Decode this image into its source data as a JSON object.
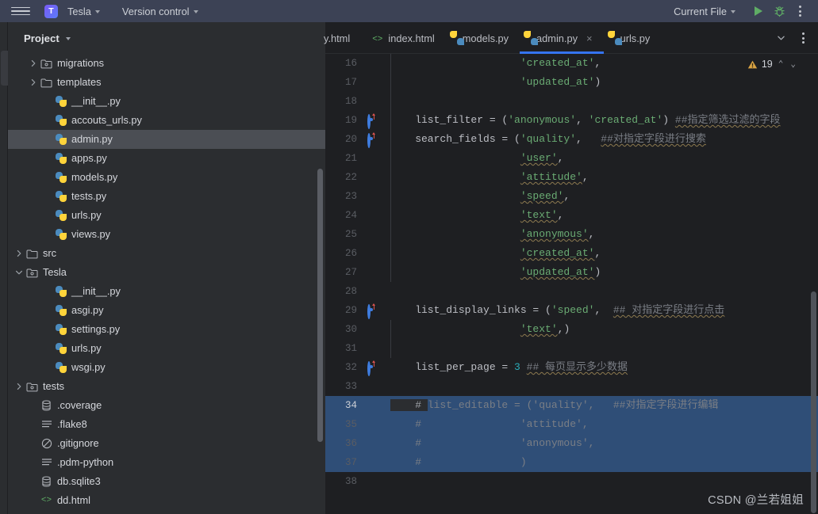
{
  "titlebar": {
    "menu_icon": "hamburger-icon",
    "project_badge": "T",
    "project_name": "Tesla",
    "version_control": "Version control",
    "run_config": "Current File",
    "run_icon": "run-play-icon",
    "debug_icon": "debug-bug-icon",
    "more_icon": "more-vertical-icon"
  },
  "project_panel": {
    "title": "Project",
    "tree": [
      {
        "label": "migrations",
        "icon": "folder-module-icon",
        "indent": 3,
        "arrow": "right",
        "selected": false
      },
      {
        "label": "templates",
        "icon": "folder-icon",
        "indent": 3,
        "arrow": "right",
        "selected": false
      },
      {
        "label": "__init__.py",
        "icon": "python-icon",
        "indent": 4,
        "arrow": "none",
        "selected": false
      },
      {
        "label": "accouts_urls.py",
        "icon": "python-icon",
        "indent": 4,
        "arrow": "none",
        "selected": false
      },
      {
        "label": "admin.py",
        "icon": "python-icon",
        "indent": 4,
        "arrow": "none",
        "selected": true
      },
      {
        "label": "apps.py",
        "icon": "python-icon",
        "indent": 4,
        "arrow": "none",
        "selected": false
      },
      {
        "label": "models.py",
        "icon": "python-icon",
        "indent": 4,
        "arrow": "none",
        "selected": false
      },
      {
        "label": "tests.py",
        "icon": "python-icon",
        "indent": 4,
        "arrow": "none",
        "selected": false
      },
      {
        "label": "urls.py",
        "icon": "python-icon",
        "indent": 4,
        "arrow": "none",
        "selected": false
      },
      {
        "label": "views.py",
        "icon": "python-icon",
        "indent": 4,
        "arrow": "none",
        "selected": false
      },
      {
        "label": "src",
        "icon": "folder-icon",
        "indent": 2,
        "arrow": "right",
        "selected": false
      },
      {
        "label": "Tesla",
        "icon": "folder-module-icon",
        "indent": 2,
        "arrow": "down",
        "selected": false
      },
      {
        "label": "__init__.py",
        "icon": "python-icon",
        "indent": 4,
        "arrow": "none",
        "selected": false
      },
      {
        "label": "asgi.py",
        "icon": "python-icon",
        "indent": 4,
        "arrow": "none",
        "selected": false
      },
      {
        "label": "settings.py",
        "icon": "python-icon",
        "indent": 4,
        "arrow": "none",
        "selected": false
      },
      {
        "label": "urls.py",
        "icon": "python-icon",
        "indent": 4,
        "arrow": "none",
        "selected": false
      },
      {
        "label": "wsgi.py",
        "icon": "python-icon",
        "indent": 4,
        "arrow": "none",
        "selected": false
      },
      {
        "label": "tests",
        "icon": "folder-module-icon",
        "indent": 2,
        "arrow": "right",
        "selected": false
      },
      {
        "label": ".coverage",
        "icon": "database-icon",
        "indent": 3,
        "arrow": "none",
        "selected": false
      },
      {
        "label": ".flake8",
        "icon": "text-file-icon",
        "indent": 3,
        "arrow": "none",
        "selected": false
      },
      {
        "label": ".gitignore",
        "icon": "ignore-file-icon",
        "indent": 3,
        "arrow": "none",
        "selected": false
      },
      {
        "label": ".pdm-python",
        "icon": "text-file-icon",
        "indent": 3,
        "arrow": "none",
        "selected": false
      },
      {
        "label": "db.sqlite3",
        "icon": "database-icon",
        "indent": 3,
        "arrow": "none",
        "selected": false
      },
      {
        "label": "dd.html",
        "icon": "html-icon",
        "indent": 3,
        "arrow": "none",
        "selected": false
      }
    ]
  },
  "editor_tabs": {
    "tabs": [
      {
        "label": "y.html",
        "icon": "html-icon",
        "active": false,
        "clipped": true,
        "closable": false
      },
      {
        "label": "index.html",
        "icon": "html-icon",
        "active": false,
        "clipped": false,
        "closable": false
      },
      {
        "label": "models.py",
        "icon": "python-icon",
        "active": false,
        "clipped": false,
        "closable": false
      },
      {
        "label": "admin.py",
        "icon": "python-icon",
        "active": true,
        "clipped": false,
        "closable": true
      },
      {
        "label": "urls.py",
        "icon": "python-icon",
        "active": false,
        "clipped": false,
        "closable": false
      }
    ],
    "close_label": "×",
    "dropdown_icon": "chevron-down-icon",
    "more_icon": "more-vertical-icon"
  },
  "inspection": {
    "warning_icon": "warning-triangle-icon",
    "warning_count": "19",
    "prev_icon": "⌃",
    "next_icon": "⌄"
  },
  "code": {
    "file": "admin.py",
    "lines": [
      {
        "n": "16",
        "gutter": "none",
        "state": "normal",
        "segments": [
          {
            "t": "                     ",
            "c": "plain"
          },
          {
            "t": "'created_at'",
            "c": "str"
          },
          {
            "t": ",",
            "c": "plain"
          }
        ]
      },
      {
        "n": "17",
        "gutter": "none",
        "state": "normal",
        "segments": [
          {
            "t": "                     ",
            "c": "plain"
          },
          {
            "t": "'updated_at'",
            "c": "str"
          },
          {
            "t": ")",
            "c": "plain"
          }
        ]
      },
      {
        "n": "18",
        "gutter": "none",
        "state": "normal",
        "segments": []
      },
      {
        "n": "19",
        "gutter": "override",
        "state": "normal",
        "segments": [
          {
            "t": "    list_filter = (",
            "c": "plain"
          },
          {
            "t": "'anonymous'",
            "c": "str"
          },
          {
            "t": ", ",
            "c": "plain"
          },
          {
            "t": "'created_at'",
            "c": "str"
          },
          {
            "t": ") ",
            "c": "plain"
          },
          {
            "t": "##指定筛选过滤的字段",
            "c": "cmt-wavy"
          }
        ]
      },
      {
        "n": "20",
        "gutter": "override",
        "state": "normal",
        "segments": [
          {
            "t": "    search_fields = (",
            "c": "plain"
          },
          {
            "t": "'quality'",
            "c": "str"
          },
          {
            "t": ",   ",
            "c": "plain"
          },
          {
            "t": "##对指定字段进行搜索",
            "c": "cmt-wavy"
          }
        ]
      },
      {
        "n": "21",
        "gutter": "none",
        "state": "normal",
        "segments": [
          {
            "t": "                     ",
            "c": "plain"
          },
          {
            "t": "'user'",
            "c": "str-wavy"
          },
          {
            "t": ",",
            "c": "plain"
          }
        ]
      },
      {
        "n": "22",
        "gutter": "none",
        "state": "normal",
        "segments": [
          {
            "t": "                     ",
            "c": "plain"
          },
          {
            "t": "'attitude'",
            "c": "str-wavy"
          },
          {
            "t": ",",
            "c": "plain"
          }
        ]
      },
      {
        "n": "23",
        "gutter": "none",
        "state": "normal",
        "segments": [
          {
            "t": "                     ",
            "c": "plain"
          },
          {
            "t": "'speed'",
            "c": "str-wavy"
          },
          {
            "t": ",",
            "c": "plain"
          }
        ]
      },
      {
        "n": "24",
        "gutter": "none",
        "state": "normal",
        "segments": [
          {
            "t": "                     ",
            "c": "plain"
          },
          {
            "t": "'text'",
            "c": "str-wavy"
          },
          {
            "t": ",",
            "c": "plain"
          }
        ]
      },
      {
        "n": "25",
        "gutter": "none",
        "state": "normal",
        "segments": [
          {
            "t": "                     ",
            "c": "plain"
          },
          {
            "t": "'anonymous'",
            "c": "str-wavy"
          },
          {
            "t": ",",
            "c": "plain"
          }
        ]
      },
      {
        "n": "26",
        "gutter": "none",
        "state": "normal",
        "segments": [
          {
            "t": "                     ",
            "c": "plain"
          },
          {
            "t": "'created_at'",
            "c": "str-wavy"
          },
          {
            "t": ",",
            "c": "plain"
          }
        ]
      },
      {
        "n": "27",
        "gutter": "none",
        "state": "normal",
        "segments": [
          {
            "t": "                     ",
            "c": "plain"
          },
          {
            "t": "'updated_at'",
            "c": "str-wavy"
          },
          {
            "t": ")",
            "c": "plain"
          }
        ]
      },
      {
        "n": "28",
        "gutter": "none",
        "state": "normal",
        "segments": []
      },
      {
        "n": "29",
        "gutter": "override",
        "state": "normal",
        "segments": [
          {
            "t": "    list_display_links = (",
            "c": "plain"
          },
          {
            "t": "'speed'",
            "c": "str"
          },
          {
            "t": ",  ",
            "c": "plain"
          },
          {
            "t": "## 对指定字段进行点击",
            "c": "cmt-wavy"
          }
        ]
      },
      {
        "n": "30",
        "gutter": "none",
        "state": "normal",
        "segments": [
          {
            "t": "                     ",
            "c": "plain"
          },
          {
            "t": "'text'",
            "c": "str-wavy"
          },
          {
            "t": ",)",
            "c": "plain"
          }
        ]
      },
      {
        "n": "31",
        "gutter": "none",
        "state": "normal",
        "segments": []
      },
      {
        "n": "32",
        "gutter": "override",
        "state": "normal",
        "segments": [
          {
            "t": "    list_per_page = ",
            "c": "plain"
          },
          {
            "t": "3",
            "c": "num"
          },
          {
            "t": " ",
            "c": "plain"
          },
          {
            "t": "## 每页显示多少数据",
            "c": "cmt-wavy"
          }
        ]
      },
      {
        "n": "33",
        "gutter": "bulb",
        "state": "normal",
        "segments": []
      },
      {
        "n": "34",
        "gutter": "none",
        "state": "current-selected",
        "segments": [
          {
            "t": "    # ",
            "c": "cmt-caret"
          },
          {
            "t": "list_editable = ('quality',   ##对指定字段进行编辑",
            "c": "cmt"
          }
        ]
      },
      {
        "n": "35",
        "gutter": "none",
        "state": "selected",
        "segments": [
          {
            "t": "    #                ",
            "c": "cmt"
          },
          {
            "t": "'attitude',",
            "c": "cmt"
          }
        ]
      },
      {
        "n": "36",
        "gutter": "none",
        "state": "selected",
        "segments": [
          {
            "t": "    #                ",
            "c": "cmt"
          },
          {
            "t": "'anonymous',",
            "c": "cmt"
          }
        ]
      },
      {
        "n": "37",
        "gutter": "none",
        "state": "selected",
        "segments": [
          {
            "t": "    #                ",
            "c": "cmt"
          },
          {
            "t": ")",
            "c": "cmt"
          }
        ]
      },
      {
        "n": "38",
        "gutter": "none",
        "state": "normal",
        "segments": []
      }
    ]
  },
  "watermark": "CSDN @兰若姐姐",
  "colors": {
    "accent": "#3574f0",
    "titlebar_bg": "#3c4255",
    "panel_bg": "#2b2d30",
    "editor_bg": "#1e1f22",
    "selection": "#2f4e77",
    "string": "#6aab73",
    "comment": "#7a7e85",
    "number": "#2aacb8",
    "text": "#bcbec4"
  }
}
